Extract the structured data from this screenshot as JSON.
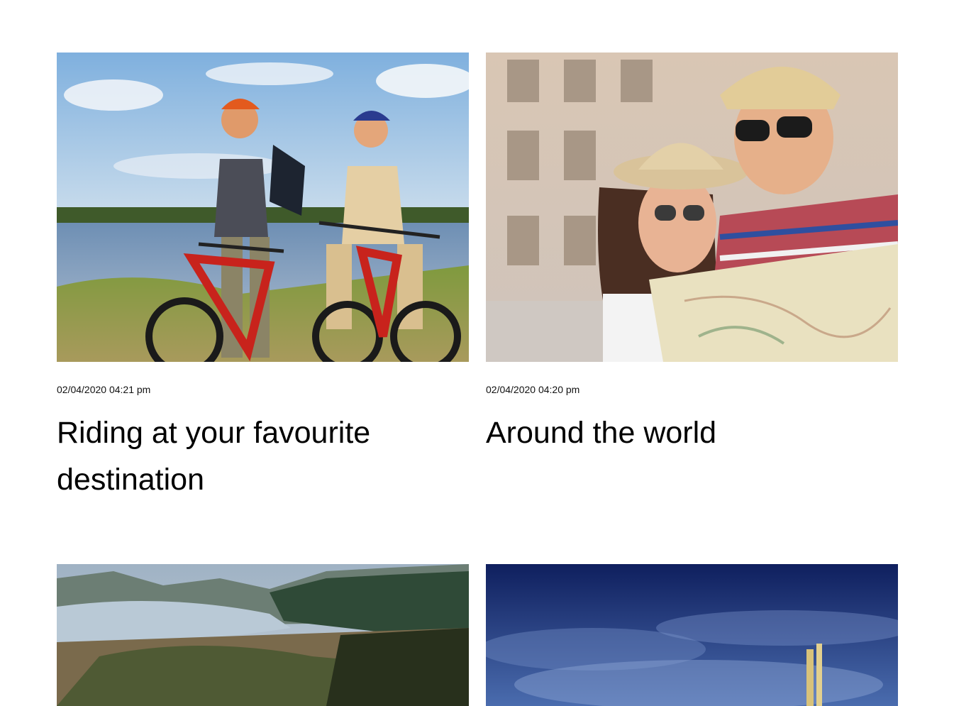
{
  "posts": [
    {
      "date": "02/04/2020 04:21 pm",
      "title": "Riding at your favourite destination",
      "image_subject": "two-cyclists-by-lake"
    },
    {
      "date": "02/04/2020 04:20 pm",
      "title": "Around the world",
      "image_subject": "tourist-couple-with-map"
    },
    {
      "image_subject": "river-valley-landscape"
    },
    {
      "image_subject": "deep-blue-sky"
    }
  ],
  "colors": {
    "text": "#000000",
    "background": "#ffffff"
  }
}
